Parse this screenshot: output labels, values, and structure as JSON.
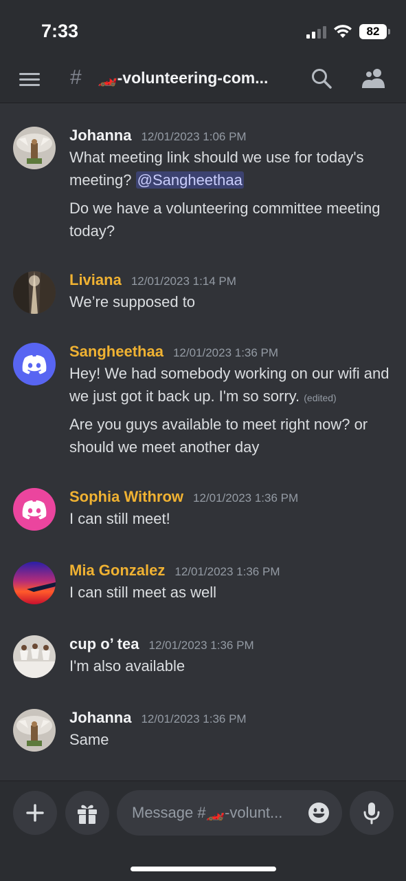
{
  "status_bar": {
    "time": "7:33",
    "battery": "82"
  },
  "header": {
    "channel_hash": "#",
    "channel_name": "🏎️-volunteering-com..."
  },
  "colors": {
    "background": "#313338",
    "header": "#2b2d31",
    "gold_username": "#f0b232",
    "mention_bg": "#3c4270",
    "discord_blurple": "#5865f2",
    "discord_pink": "#eb459e"
  },
  "messages": [
    {
      "username": "Johanna",
      "timestamp": "12/01/2023 1:06 PM",
      "avatar_icon": "figurine-avatar",
      "line1_text": "What meeting link should we use for today's meeting? ",
      "mention": "@Sangheethaa",
      "line2_text": "Do we have a volunteering committee meeting today?"
    },
    {
      "username": "Liviana",
      "timestamp": "12/01/2023 1:14 PM",
      "avatar_icon": "forest-path-avatar",
      "text": "We’re supposed to"
    },
    {
      "username": "Sangheethaa",
      "timestamp": "12/01/2023 1:36 PM",
      "avatar_icon": "discord-logo-avatar",
      "line1_text": "Hey! We had somebody working on our wifi and we just got it back up. I'm so sorry. ",
      "edited": "(edited)",
      "line2_text": "Are you guys available to meet right now? or should we meet another day"
    },
    {
      "username": "Sophia Withrow",
      "timestamp": "12/01/2023 1:36 PM",
      "avatar_icon": "discord-logo-avatar",
      "text": "I can still meet!"
    },
    {
      "username": "Mia Gonzalez",
      "timestamp": "12/01/2023 1:36 PM",
      "avatar_icon": "sunset-wing-avatar",
      "text": "I can still meet as well"
    },
    {
      "username": "cup o’ tea",
      "timestamp": "12/01/2023 1:36 PM",
      "avatar_icon": "teacups-avatar",
      "text": "I'm also available"
    },
    {
      "username": "Johanna",
      "timestamp": "12/01/2023 1:36 PM",
      "avatar_icon": "figurine-avatar",
      "text": "Same"
    }
  ],
  "composer": {
    "placeholder": "Message #🏎️-volunt..."
  }
}
